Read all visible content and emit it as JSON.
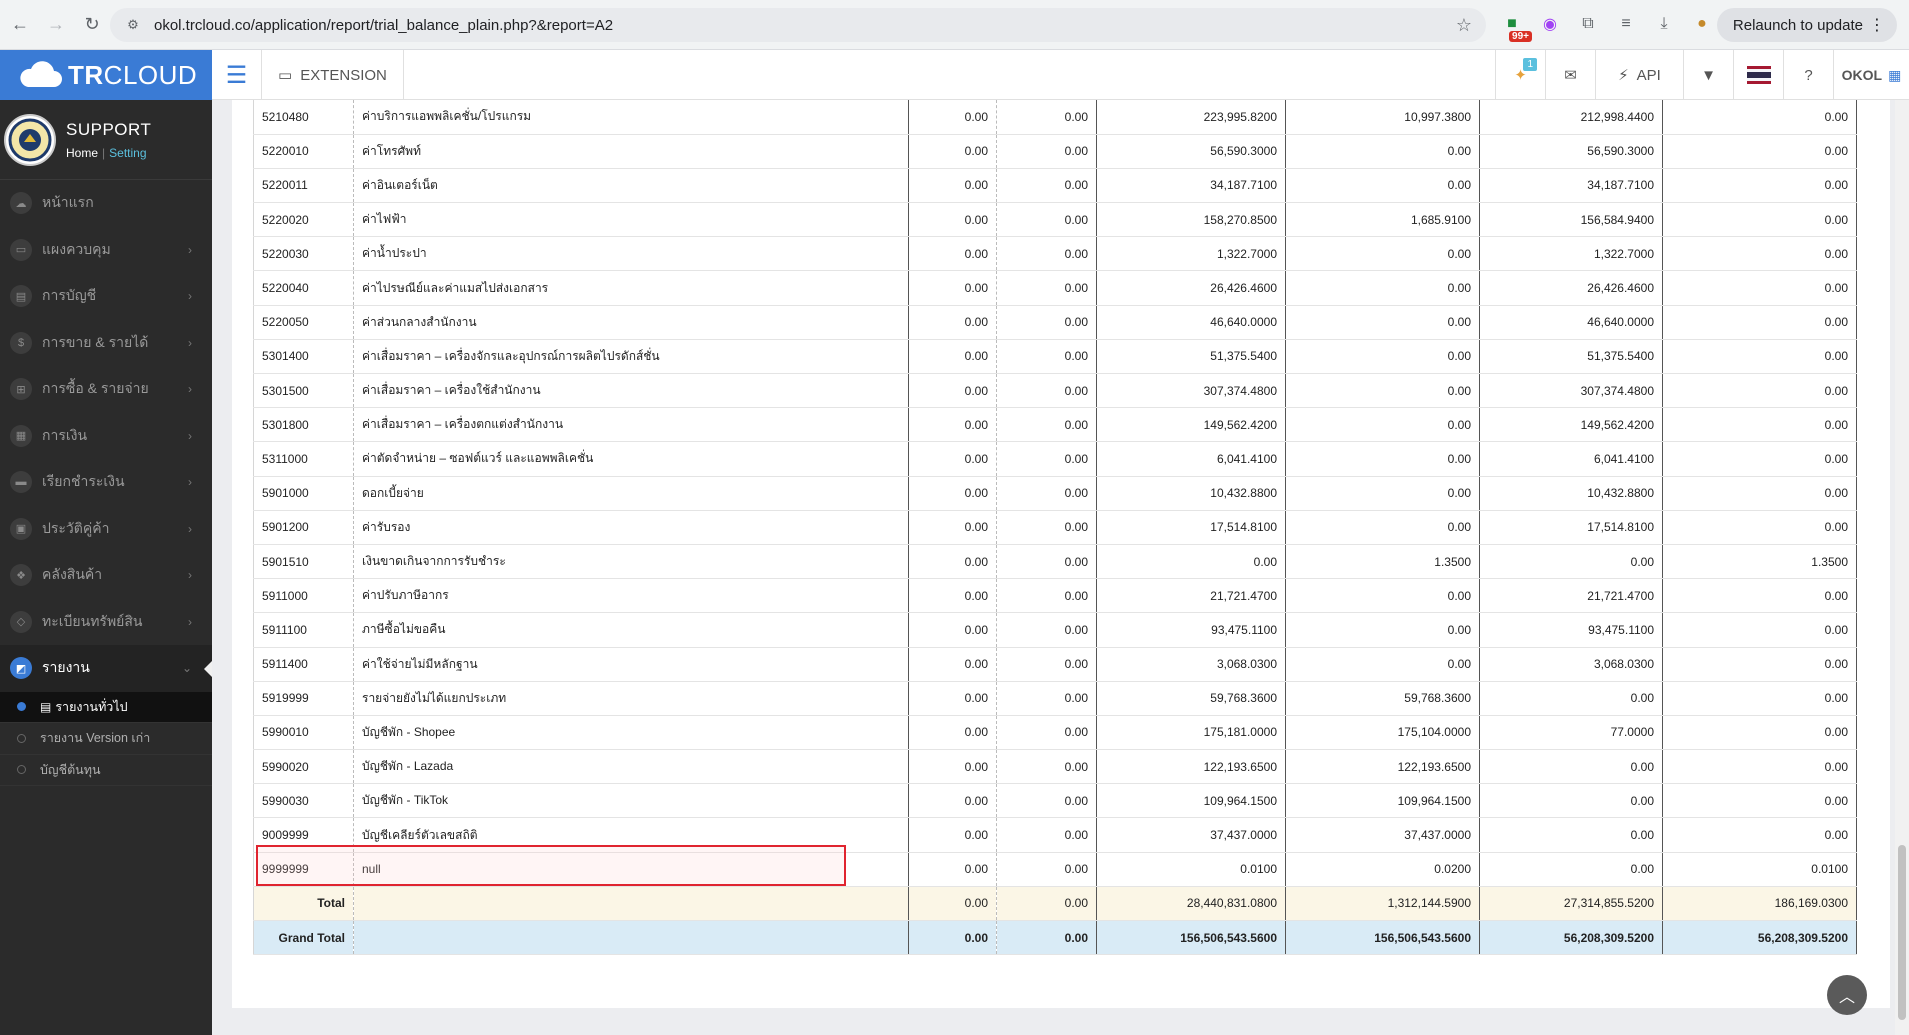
{
  "browser": {
    "url": "okol.trcloud.co/application/report/trial_balance_plain.php?&report=A2",
    "ext_badge": "99+",
    "relaunch_label": "Relaunch to update"
  },
  "header": {
    "logo_bold": "TR",
    "logo_light": "CLOUD",
    "extension_label": "EXTENSION",
    "notif_count": "1",
    "api_label": "API",
    "company": "OKOL"
  },
  "sidebar": {
    "profile_name": "SUPPORT",
    "home_link": "Home",
    "setting_link": "Setting",
    "items": [
      {
        "label": "หน้าแรก",
        "icon": "cloud-icon",
        "glyph": "☁",
        "chevron": false
      },
      {
        "label": "แผงควบคุม",
        "icon": "monitor-icon",
        "glyph": "▭",
        "chevron": true
      },
      {
        "label": "การบัญชี",
        "icon": "book-icon",
        "glyph": "▤",
        "chevron": true
      },
      {
        "label": "การขาย & รายได้",
        "icon": "dollar-icon",
        "glyph": "$",
        "chevron": true
      },
      {
        "label": "การซื้อ & รายจ่าย",
        "icon": "cart-icon",
        "glyph": "⊞",
        "chevron": true
      },
      {
        "label": "การเงิน",
        "icon": "calendar-icon",
        "glyph": "▦",
        "chevron": true
      },
      {
        "label": "เรียกชำระเงิน",
        "icon": "card-icon",
        "glyph": "▬",
        "chevron": true
      },
      {
        "label": "ประวัติคู่ค้า",
        "icon": "contact-icon",
        "glyph": "▣",
        "chevron": true
      },
      {
        "label": "คลังสินค้า",
        "icon": "cubes-icon",
        "glyph": "❖",
        "chevron": true
      },
      {
        "label": "ทะเบียนทรัพย์สิน",
        "icon": "diamond-icon",
        "glyph": "◇",
        "chevron": true
      }
    ],
    "active_item": {
      "label": "รายงาน",
      "icon": "report-icon",
      "glyph": "◩"
    },
    "sub_items": [
      {
        "label": "รายงานทั่วไป",
        "active": true
      },
      {
        "label": "รายงาน Version เก่า",
        "active": false
      },
      {
        "label": "บัญชีต้นทุน",
        "active": false
      }
    ]
  },
  "table": {
    "rows": [
      {
        "code": "5210480",
        "name": "ค่าบริการแอพพลิเคชั่น/โปรแกรม",
        "c1": "0.00",
        "c2": "0.00",
        "c3": "223,995.8200",
        "c4": "10,997.3800",
        "c5": "212,998.4400",
        "c6": "0.00"
      },
      {
        "code": "5220010",
        "name": "ค่าโทรศัพท์",
        "c1": "0.00",
        "c2": "0.00",
        "c3": "56,590.3000",
        "c4": "0.00",
        "c5": "56,590.3000",
        "c6": "0.00"
      },
      {
        "code": "5220011",
        "name": "ค่าอินเตอร์เน็ต",
        "c1": "0.00",
        "c2": "0.00",
        "c3": "34,187.7100",
        "c4": "0.00",
        "c5": "34,187.7100",
        "c6": "0.00"
      },
      {
        "code": "5220020",
        "name": "ค่าไฟฟ้า",
        "c1": "0.00",
        "c2": "0.00",
        "c3": "158,270.8500",
        "c4": "1,685.9100",
        "c5": "156,584.9400",
        "c6": "0.00"
      },
      {
        "code": "5220030",
        "name": "ค่าน้ำประปา",
        "c1": "0.00",
        "c2": "0.00",
        "c3": "1,322.7000",
        "c4": "0.00",
        "c5": "1,322.7000",
        "c6": "0.00"
      },
      {
        "code": "5220040",
        "name": "ค่าไปรษณีย์และค่าแมสไปส่งเอกสาร",
        "c1": "0.00",
        "c2": "0.00",
        "c3": "26,426.4600",
        "c4": "0.00",
        "c5": "26,426.4600",
        "c6": "0.00"
      },
      {
        "code": "5220050",
        "name": "ค่าส่วนกลางสำนักงาน",
        "c1": "0.00",
        "c2": "0.00",
        "c3": "46,640.0000",
        "c4": "0.00",
        "c5": "46,640.0000",
        "c6": "0.00"
      },
      {
        "code": "5301400",
        "name": "ค่าเสื่อมราคา – เครื่องจักรและอุปกรณ์การผลิตไปรดักส์ชั่น",
        "c1": "0.00",
        "c2": "0.00",
        "c3": "51,375.5400",
        "c4": "0.00",
        "c5": "51,375.5400",
        "c6": "0.00"
      },
      {
        "code": "5301500",
        "name": "ค่าเสื่อมราคา – เครื่องใช้สำนักงาน",
        "c1": "0.00",
        "c2": "0.00",
        "c3": "307,374.4800",
        "c4": "0.00",
        "c5": "307,374.4800",
        "c6": "0.00"
      },
      {
        "code": "5301800",
        "name": "ค่าเสื่อมราคา – เครื่องตกแต่งสำนักงาน",
        "c1": "0.00",
        "c2": "0.00",
        "c3": "149,562.4200",
        "c4": "0.00",
        "c5": "149,562.4200",
        "c6": "0.00"
      },
      {
        "code": "5311000",
        "name": "ค่าตัดจำหน่าย – ซอฟต์แวร์ และแอพพลิเคชั่น",
        "c1": "0.00",
        "c2": "0.00",
        "c3": "6,041.4100",
        "c4": "0.00",
        "c5": "6,041.4100",
        "c6": "0.00"
      },
      {
        "code": "5901000",
        "name": "ดอกเบี้ยจ่าย",
        "c1": "0.00",
        "c2": "0.00",
        "c3": "10,432.8800",
        "c4": "0.00",
        "c5": "10,432.8800",
        "c6": "0.00"
      },
      {
        "code": "5901200",
        "name": "ค่ารับรอง",
        "c1": "0.00",
        "c2": "0.00",
        "c3": "17,514.8100",
        "c4": "0.00",
        "c5": "17,514.8100",
        "c6": "0.00"
      },
      {
        "code": "5901510",
        "name": "เงินขาดเกินจากการรับชำระ",
        "c1": "0.00",
        "c2": "0.00",
        "c3": "0.00",
        "c4": "1.3500",
        "c5": "0.00",
        "c6": "1.3500"
      },
      {
        "code": "5911000",
        "name": "ค่าปรับภาษีอากร",
        "c1": "0.00",
        "c2": "0.00",
        "c3": "21,721.4700",
        "c4": "0.00",
        "c5": "21,721.4700",
        "c6": "0.00"
      },
      {
        "code": "5911100",
        "name": "ภาษีซื้อไม่ขอคืน",
        "c1": "0.00",
        "c2": "0.00",
        "c3": "93,475.1100",
        "c4": "0.00",
        "c5": "93,475.1100",
        "c6": "0.00"
      },
      {
        "code": "5911400",
        "name": "ค่าใช้จ่ายไม่มีหลักฐาน",
        "c1": "0.00",
        "c2": "0.00",
        "c3": "3,068.0300",
        "c4": "0.00",
        "c5": "3,068.0300",
        "c6": "0.00"
      },
      {
        "code": "5919999",
        "name": "รายจ่ายยังไม่ได้แยกประเภท",
        "c1": "0.00",
        "c2": "0.00",
        "c3": "59,768.3600",
        "c4": "59,768.3600",
        "c5": "0.00",
        "c6": "0.00"
      },
      {
        "code": "5990010",
        "name": "บัญชีพัก - Shopee",
        "c1": "0.00",
        "c2": "0.00",
        "c3": "175,181.0000",
        "c4": "175,104.0000",
        "c5": "77.0000",
        "c6": "0.00"
      },
      {
        "code": "5990020",
        "name": "บัญชีพัก - Lazada",
        "c1": "0.00",
        "c2": "0.00",
        "c3": "122,193.6500",
        "c4": "122,193.6500",
        "c5": "0.00",
        "c6": "0.00"
      },
      {
        "code": "5990030",
        "name": "บัญชีพัก - TikTok",
        "c1": "0.00",
        "c2": "0.00",
        "c3": "109,964.1500",
        "c4": "109,964.1500",
        "c5": "0.00",
        "c6": "0.00"
      },
      {
        "code": "9009999",
        "name": "บัญชีเคลียร์ตัวเลขสถิติ",
        "c1": "0.00",
        "c2": "0.00",
        "c3": "37,437.0000",
        "c4": "37,437.0000",
        "c5": "0.00",
        "c6": "0.00"
      },
      {
        "code": "9999999",
        "name": "null",
        "c1": "0.00",
        "c2": "0.00",
        "c3": "0.0100",
        "c4": "0.0200",
        "c5": "0.00",
        "c6": "0.0100"
      }
    ],
    "total": {
      "label": "Total",
      "c1": "0.00",
      "c2": "0.00",
      "c3": "28,440,831.0800",
      "c4": "1,312,144.5900",
      "c5": "27,314,855.5200",
      "c6": "186,169.0300"
    },
    "grand_total": {
      "label": "Grand Total",
      "c1": "0.00",
      "c2": "0.00",
      "c3": "156,506,543.5600",
      "c4": "156,506,543.5600",
      "c5": "56,208,309.5200",
      "c6": "56,208,309.5200"
    }
  },
  "colors": {
    "brand_blue": "#3a7bd5",
    "highlight_red": "#e0242f",
    "total_bg": "#fbf6e6",
    "grand_total_bg": "#d9ebf6"
  }
}
